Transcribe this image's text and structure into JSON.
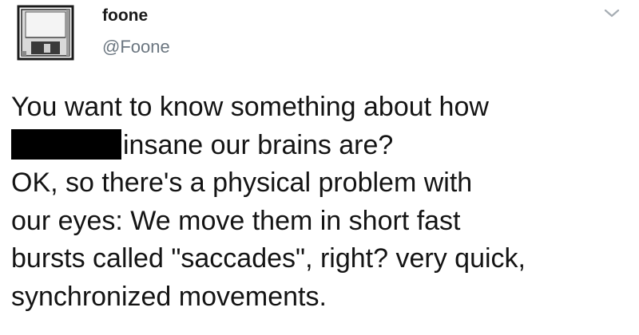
{
  "tweet": {
    "author": {
      "name": "foone",
      "handle": "@Foone",
      "avatar_icon": "floppy-disk-icon"
    },
    "menu_icon": "chevron-down-icon",
    "text_lines": [
      "You want to know something about how",
      "insane our brains are?",
      "OK, so there's a physical problem with",
      "our eyes: We move them in short fast",
      "bursts called \"saccades\", right? very quick,",
      "synchronized movements."
    ],
    "redacted_word": true
  },
  "colors": {
    "background": "#ffffff",
    "text": "#141414",
    "handle": "#6b7680",
    "redaction": "#000000"
  }
}
